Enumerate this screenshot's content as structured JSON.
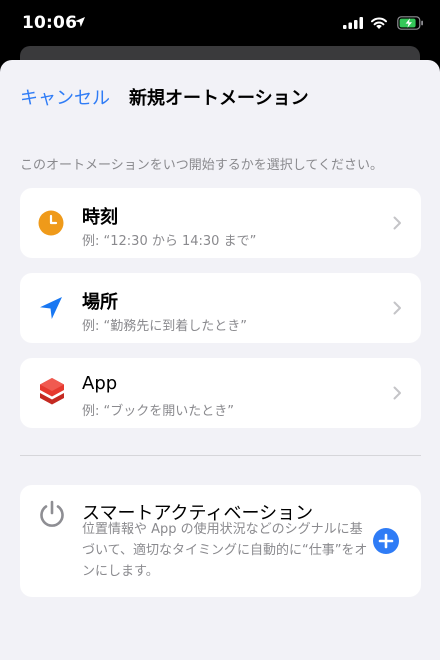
{
  "status_bar": {
    "time": "10:06"
  },
  "nav": {
    "cancel_label": "キャンセル",
    "title": "新規オートメーション"
  },
  "hint": "このオートメーションをいつ開始するかを選択してください。",
  "items": [
    {
      "title": "時刻",
      "subtitle": "例: “12:30 から 14:30 まで”",
      "icon": "clock-icon"
    },
    {
      "title": "場所",
      "subtitle": "例: “勤務先に到着したとき”",
      "icon": "location-arrow-icon"
    },
    {
      "title": "App",
      "subtitle": "例: “ブックを開いたとき”",
      "icon": "app-stack-icon"
    }
  ],
  "smart": {
    "title": "スマートアクティベーション",
    "description": "位置情報や App の使用状況などのシグナルに基づいて、適切なタイミングに自動的に“仕事”をオンにします。",
    "icon": "power-icon",
    "action_icon": "plus-circle-icon"
  },
  "colors": {
    "accent": "#2f7cf6",
    "clock": "#ef9a1a",
    "location": "#1877f2",
    "app": "#e6392f",
    "background": "#f2f2f7"
  }
}
